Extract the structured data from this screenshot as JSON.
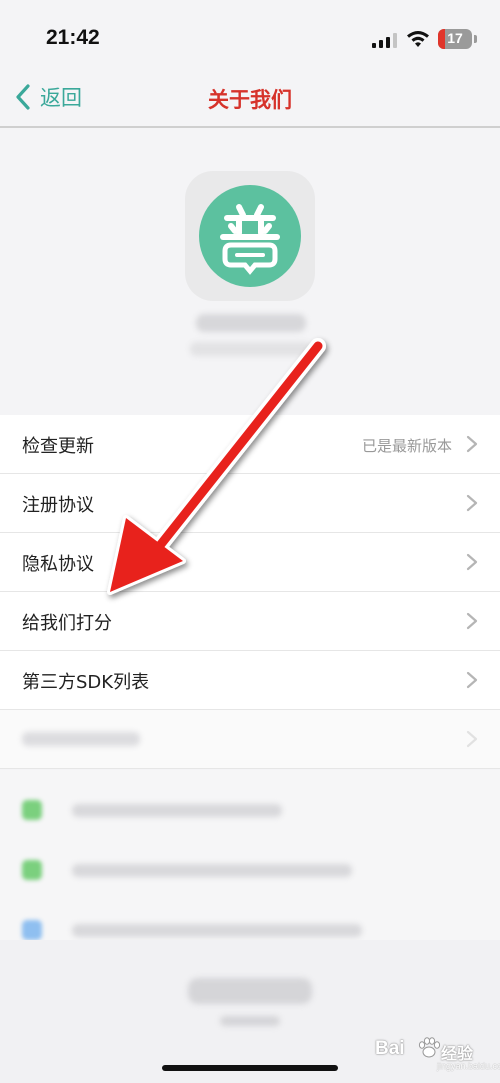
{
  "status_bar": {
    "time": "21:42",
    "battery": "17"
  },
  "nav": {
    "back_label": "返回",
    "title": "关于我们"
  },
  "app": {
    "logo_char": "普"
  },
  "settings": {
    "items": [
      {
        "label": "检查更新",
        "value": "已是最新版本"
      },
      {
        "label": "注册协议",
        "value": ""
      },
      {
        "label": "隐私协议",
        "value": ""
      },
      {
        "label": "给我们打分",
        "value": ""
      },
      {
        "label": "第三方SDK列表",
        "value": ""
      }
    ]
  },
  "watermark": {
    "left": "Bai",
    "right": "经验",
    "sub": "jingyan.baidu.com"
  },
  "colors": {
    "accent_green": "#5cc19f",
    "nav_back": "#3aa89a",
    "title_red": "#d6332b",
    "arrow_red": "#e8201f"
  },
  "icons": [
    "signal-icon",
    "wifi-icon",
    "battery-icon",
    "back-chevron-icon",
    "chevron-right-icon",
    "red-arrow-annotation"
  ]
}
